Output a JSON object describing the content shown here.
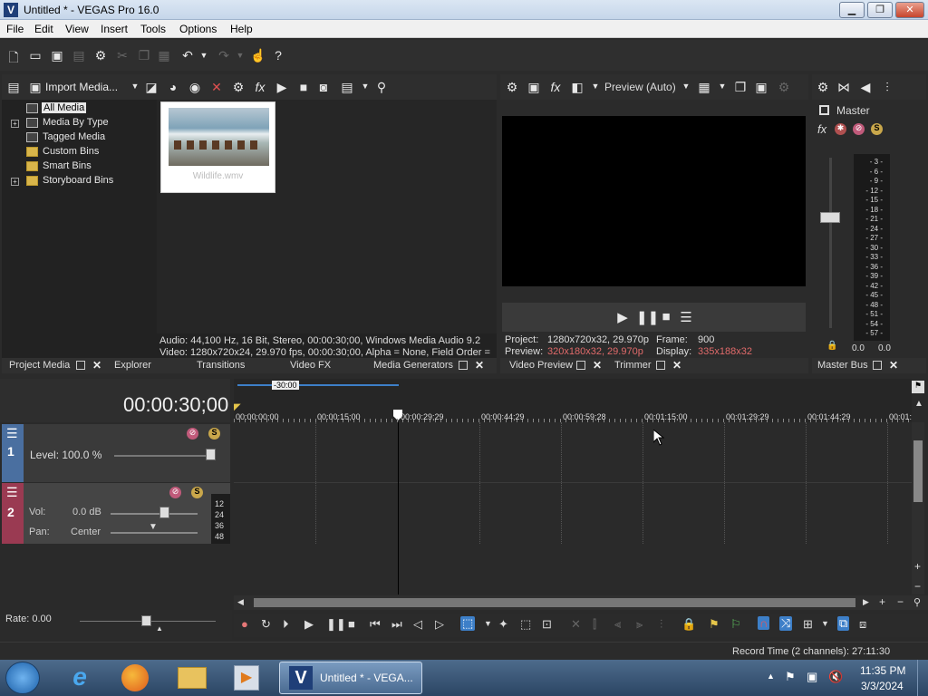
{
  "window": {
    "title": "Untitled * - VEGAS Pro 16.0",
    "logo": "V",
    "min": "▁",
    "max": "❐",
    "close": "✕"
  },
  "menu": [
    "File",
    "Edit",
    "View",
    "Insert",
    "Tools",
    "Options",
    "Help"
  ],
  "media_panel": {
    "import_label": "Import Media...",
    "tree": [
      "All Media",
      "Media By Type",
      "Tagged Media",
      "Custom Bins",
      "Smart Bins",
      "Storyboard Bins"
    ],
    "thumb_name": "Wildlife.wmv",
    "info_audio": "Audio: 44,100 Hz, 16 Bit, Stereo, 00:00:30;00, Windows Media Audio 9.2",
    "info_video": "Video: 1280x720x24, 29.970 fps, 00:00:30;00, Alpha = None, Field Order ="
  },
  "preview": {
    "mode": "Preview (Auto)",
    "project_label": "Project:",
    "project_value": "1280x720x32, 29.970p",
    "frame_label": "Frame:",
    "frame_value": "900",
    "preview_label": "Preview:",
    "preview_value": "320x180x32, 29.970p",
    "display_label": "Display:",
    "display_value": "335x188x32"
  },
  "master": {
    "label": "Master",
    "scale": [
      "3",
      "6",
      "9",
      "12",
      "15",
      "18",
      "21",
      "24",
      "27",
      "30",
      "33",
      "36",
      "39",
      "42",
      "45",
      "48",
      "51",
      "54",
      "57"
    ],
    "left_val": "0.0",
    "right_val": "0.0"
  },
  "tabs_left": [
    "Project Media",
    "Explorer",
    "Transitions",
    "Video FX",
    "Media Generators"
  ],
  "tabs_mid": [
    "Video Preview",
    "Trimmer"
  ],
  "tabs_right": [
    "Master Bus"
  ],
  "timeline": {
    "timecode": "00:00:30;00",
    "region_label": "-30:00",
    "ruler": [
      "00:00:00;00",
      "00:00:15;00",
      "00:00:29;29",
      "00:00:44;29",
      "00:00:59;28",
      "00:01:15;00",
      "00:01:29;29",
      "00:01:44;29",
      "00:01:"
    ],
    "track1": {
      "number": "1",
      "level": "Level: 100.0 %"
    },
    "track2": {
      "number": "2",
      "vol_label": "Vol:",
      "vol_value": "0.0 dB",
      "pan_label": "Pan:",
      "pan_value": "Center",
      "meter": [
        "12",
        "24",
        "36",
        "48"
      ]
    },
    "rate": "Rate: 0.00",
    "record_time": "Record Time (2 channels): 27:11:30"
  },
  "taskbar": {
    "active_window": "Untitled * - VEGA...",
    "time": "11:35 PM",
    "date": "3/3/2024"
  },
  "colors": {
    "accent": "#3d7fc8",
    "preview_value": "#e06a6a"
  }
}
